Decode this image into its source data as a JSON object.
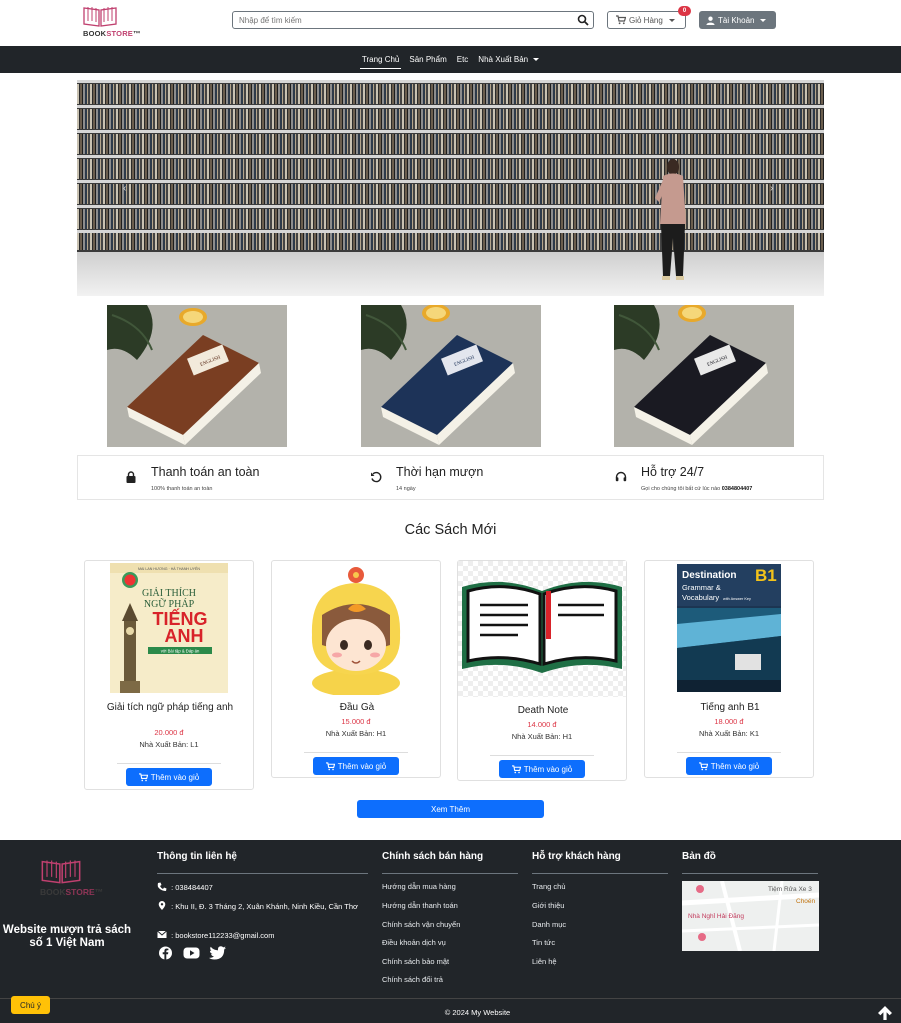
{
  "header": {
    "logo_prefix": "BOOK",
    "logo_suffix": "STORE",
    "search_placeholder": "Nhập để tìm kiếm",
    "cart_label": "Giỏ Hàng",
    "cart_count": "0",
    "account_label": "Tài Khoản"
  },
  "nav": {
    "items": [
      "Trang Chủ",
      "Sản Phẩm",
      "Etc",
      "Nhà Xuất Bản"
    ],
    "active": "Trang Chủ"
  },
  "features": [
    {
      "title": "Thanh toán an toàn",
      "subtitle": "100% thanh toán an toàn",
      "icon": "lock-icon"
    },
    {
      "title": "Thời hạn mượn",
      "subtitle": "14 ngày",
      "icon": "undo-icon"
    },
    {
      "title": "Hỗ trợ 24/7",
      "subtitle": "Gọi cho chúng tôi bất cứ lúc nào",
      "phone": "0384804407",
      "icon": "headset-icon"
    }
  ],
  "new_books": {
    "title": "Các Sách Mới",
    "add_to_cart": "Thêm vào giỏ",
    "items": [
      {
        "name": "Giải tích ngữ pháp tiếng anh",
        "price": "20.000 đ",
        "publisher": "Nhà Xuất Bản: L1",
        "cover_text": {
          "top": "GIẢI THÍCH",
          "mid": "NGỮ PHÁP",
          "big1": "TIẾNG",
          "big2": "ANH",
          "sub": "với Bài tập & Đáp án",
          "badge": "MAI LAN HƯƠNG · HÀ THANH UYÊN"
        }
      },
      {
        "name": "Đầu Gà",
        "price": "15.000 đ",
        "publisher": "Nhà Xuất Bản: H1"
      },
      {
        "name": "Death Note",
        "price": "14.000 đ",
        "publisher": "Nhà Xuất Bản: H1"
      },
      {
        "name": "Tiếng anh B1",
        "price": "18.000 đ",
        "publisher": "Nhà Xuất Bản: K1",
        "cover_text": {
          "title": "Destination",
          "level": "B1",
          "line2": "Grammar &",
          "line3": "Vocabulary",
          "line4": "with Answer Key"
        }
      }
    ],
    "more_label": "Xem Thêm"
  },
  "footer": {
    "logo_prefix": "BOOK",
    "logo_suffix": "STORE",
    "tagline": "Website mượn trả sách số 1 Việt Nam",
    "contact": {
      "title": "Thông tin liên hệ",
      "phone": ": 038484407",
      "address": ": Khu II, Đ. 3 Tháng 2, Xuân Khánh, Ninh Kiều, Cần Thơ",
      "email": ": bookstore112233@gmail.com"
    },
    "policy": {
      "title": "Chính sách bán hàng",
      "links": [
        "Hướng dẫn mua hàng",
        "Hướng dẫn thanh toán",
        "Chính sách vận chuyển",
        "Điều khoản dịch vụ",
        "Chính sách bảo mật",
        "Chính sách đổi trả"
      ]
    },
    "support": {
      "title": "Hỗ trợ khách hàng",
      "links": [
        "Trang chủ",
        "Giới thiệu",
        "Danh mục",
        "Tin tức",
        "Liên hệ"
      ]
    },
    "map": {
      "title": "Bản đồ",
      "label1": "Tiệm Rửa Xe 3",
      "label2": "Choén",
      "label3": "Nhà Nghỉ Hải Đăng"
    },
    "copyright": "© 2024 My Website",
    "note_label": "Chú ý"
  }
}
